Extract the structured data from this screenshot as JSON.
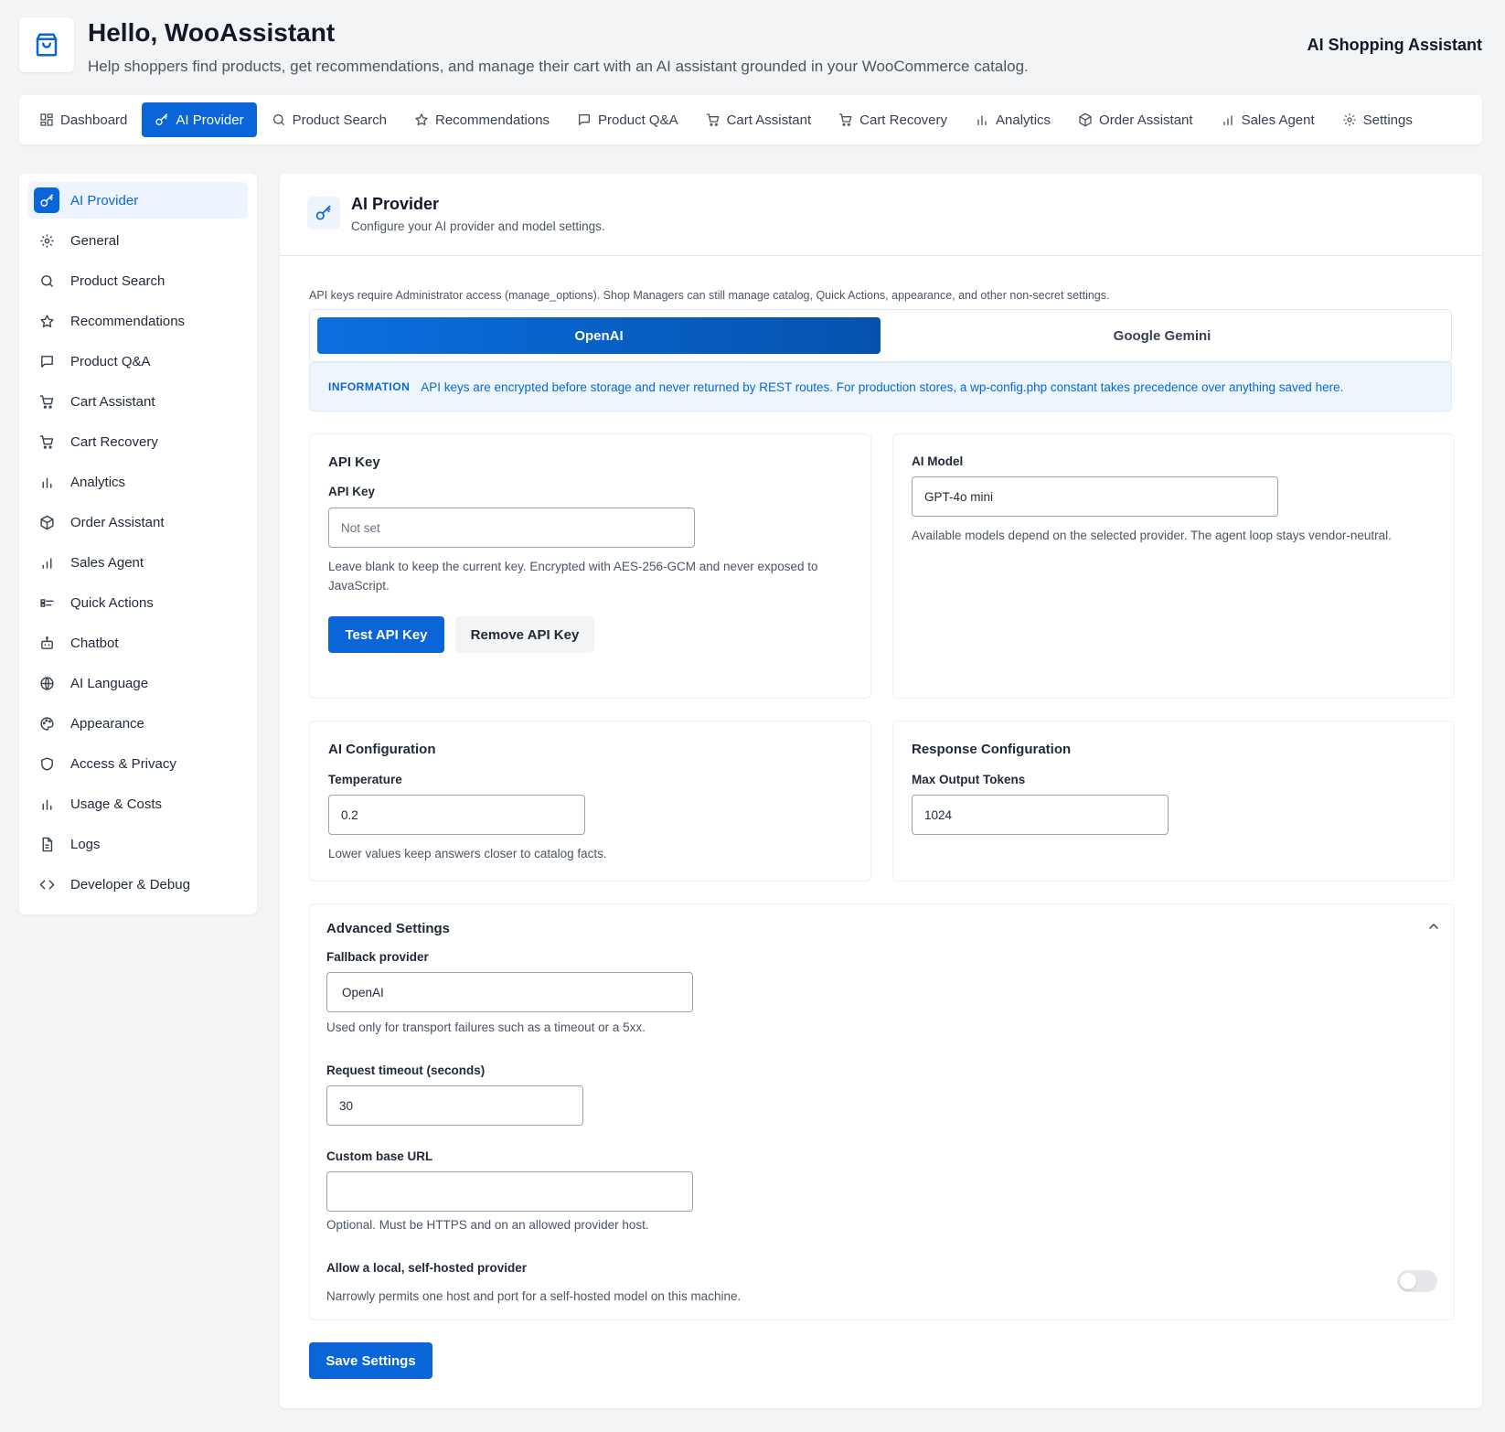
{
  "header": {
    "title": "Hello, WooAssistant",
    "subtitle": "Help shoppers find products, get recommendations, and manage their cart with an AI assistant grounded in your WooCommerce catalog.",
    "brand": "AI Shopping Assistant"
  },
  "tabs": [
    {
      "label": "Dashboard",
      "icon": "grid-icon"
    },
    {
      "label": "AI Provider",
      "icon": "key-icon",
      "active": true
    },
    {
      "label": "Product Search",
      "icon": "search-icon"
    },
    {
      "label": "Recommendations",
      "icon": "star-icon"
    },
    {
      "label": "Product Q&A",
      "icon": "chat-icon"
    },
    {
      "label": "Cart Assistant",
      "icon": "cart-icon"
    },
    {
      "label": "Cart Recovery",
      "icon": "cart-icon"
    },
    {
      "label": "Analytics",
      "icon": "bar-chart-icon"
    },
    {
      "label": "Order Assistant",
      "icon": "box-icon"
    },
    {
      "label": "Sales Agent",
      "icon": "bar-chart-icon"
    },
    {
      "label": "Settings",
      "icon": "gear-icon"
    }
  ],
  "sidebar": {
    "items": [
      {
        "label": "AI Provider",
        "icon": "key-icon",
        "active": true
      },
      {
        "label": "General",
        "icon": "gear-icon"
      },
      {
        "label": "Product Search",
        "icon": "search-icon"
      },
      {
        "label": "Recommendations",
        "icon": "star-icon"
      },
      {
        "label": "Product Q&A",
        "icon": "chat-icon"
      },
      {
        "label": "Cart Assistant",
        "icon": "cart-icon"
      },
      {
        "label": "Cart Recovery",
        "icon": "cart-icon"
      },
      {
        "label": "Analytics",
        "icon": "bar-chart-icon"
      },
      {
        "label": "Order Assistant",
        "icon": "box-icon"
      },
      {
        "label": "Sales Agent",
        "icon": "bar-chart-icon"
      },
      {
        "label": "Quick Actions",
        "icon": "quick-actions-icon"
      },
      {
        "label": "Chatbot",
        "icon": "robot-icon"
      },
      {
        "label": "AI Language",
        "icon": "globe-icon"
      },
      {
        "label": "Appearance",
        "icon": "palette-icon"
      },
      {
        "label": "Access & Privacy",
        "icon": "shield-icon"
      },
      {
        "label": "Usage & Costs",
        "icon": "bar-chart-icon"
      },
      {
        "label": "Logs",
        "icon": "document-icon"
      },
      {
        "label": "Developer & Debug",
        "icon": "code-icon"
      }
    ]
  },
  "main": {
    "title": "AI Provider",
    "subtitle": "Configure your AI provider and model settings.",
    "access_note": "API keys require Administrator access (manage_options). Shop Managers can still manage catalog, Quick Actions, appearance, and other non-secret settings.",
    "providers": [
      {
        "label": "OpenAI",
        "active": true
      },
      {
        "label": "Google Gemini",
        "active": false
      }
    ],
    "info": {
      "tag": "INFORMATION",
      "text": "API keys are encrypted before storage and never returned by REST routes. For production stores, a wp-config.php constant takes precedence over anything saved here."
    },
    "api_key_card": {
      "title": "API Key",
      "label": "API Key",
      "placeholder": "Not set",
      "value": "",
      "help": "Leave blank to keep the current key. Encrypted with AES-256-GCM and never exposed to JavaScript.",
      "test_button": "Test API Key",
      "remove_button": "Remove API Key"
    },
    "model_card": {
      "label": "AI Model",
      "value": "GPT-4o mini",
      "help": "Available models depend on the selected provider. The agent loop stays vendor-neutral."
    },
    "ai_config_card": {
      "title": "AI Configuration",
      "label": "Temperature",
      "value": "0.2",
      "help": "Lower values keep answers closer to catalog facts."
    },
    "response_card": {
      "title": "Response Configuration",
      "label": "Max Output Tokens",
      "value": "1024"
    },
    "advanced": {
      "title": "Advanced Settings",
      "fallback_label": "Fallback provider",
      "fallback_value": "OpenAI",
      "fallback_help": "Used only for transport failures such as a timeout or a 5xx.",
      "timeout_label": "Request timeout (seconds)",
      "timeout_value": "30",
      "base_url_label": "Custom base URL",
      "base_url_value": "",
      "base_url_help": "Optional. Must be HTTPS and on an allowed provider host.",
      "local_label": "Allow a local, self-hosted provider",
      "local_help": "Narrowly permits one host and port for a self-hosted model on this machine.",
      "local_enabled": false
    },
    "save_button": "Save Settings"
  },
  "colors": {
    "accent": "#0a66d8",
    "info_bg": "#eef6fd",
    "page_bg": "#f3f4f6"
  }
}
